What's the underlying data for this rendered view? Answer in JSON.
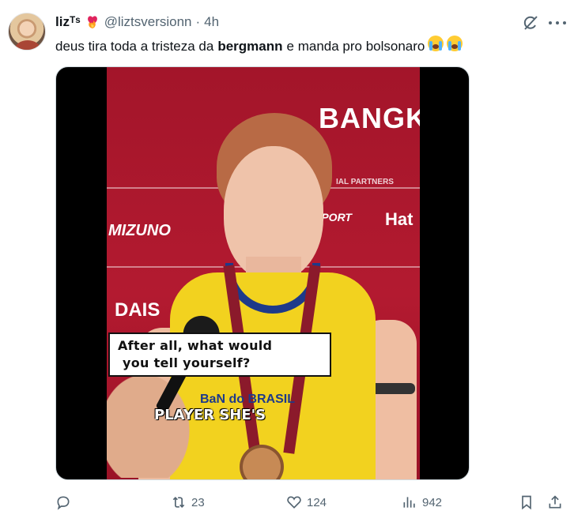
{
  "tweet": {
    "author_name": "lizᵀˢ",
    "author_emoji": "❤️‍🔥",
    "handle": "@liztsversionn",
    "separator": "·",
    "time": "4h",
    "text_before": "deus tira toda a tristeza da",
    "text_bold": "bergmann",
    "text_after": "e manda pro bolsonaro",
    "text_emojis": "😭😭"
  },
  "media": {
    "caption_line1": "After all, what would",
    "caption_line2": "you tell yourself?",
    "subtitle": "PLAYER SHE'S",
    "banner_bangk": "BANGK",
    "banner_partners": "IAL PARTNERS",
    "banner_mizuno": "MIZUNO",
    "banner_daisy": "DAIS",
    "banner_hat": "Hat",
    "banner_sport": "SPORT",
    "jersey_brand": "BANCO DO BRASIL",
    "jersey_letters": "BaN  do BRASIL"
  },
  "actions": {
    "reply_count": "",
    "retweet_count": "23",
    "like_count": "124",
    "views_count": "942"
  },
  "colors": {
    "text_primary": "#0f1419",
    "text_secondary": "#536471",
    "banner_red": "#b31a30",
    "jersey_yellow": "#f2d21f"
  },
  "icons": {
    "reply": "reply-icon",
    "retweet": "retweet-icon",
    "like": "heart-icon",
    "views": "views-icon",
    "bookmark": "bookmark-icon",
    "share": "share-icon",
    "grok": "grok-icon",
    "more": "more-icon"
  }
}
